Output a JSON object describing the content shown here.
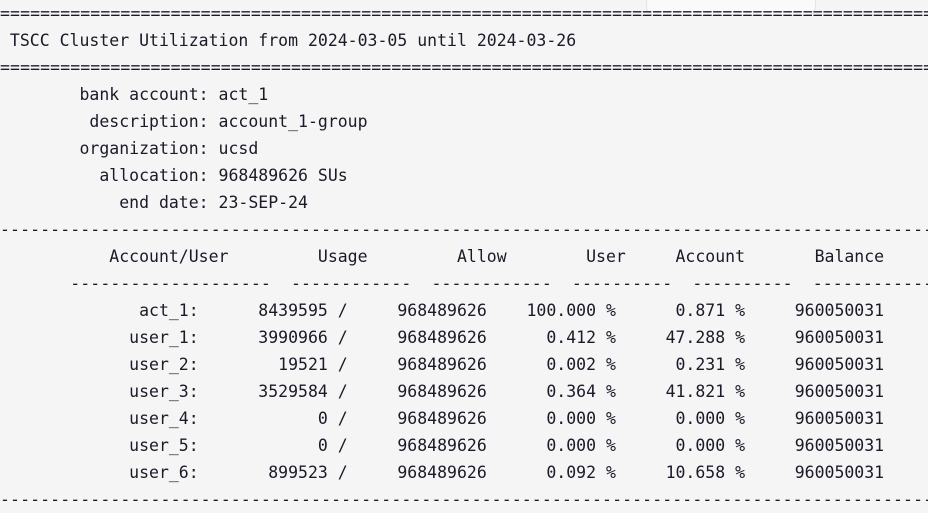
{
  "terminal": {
    "background_color": "#f5f5f5",
    "text_color": "#1a1a28",
    "rules": {
      "equals_rule": "================================================================================================",
      "dash_rule": "------------------------------------------------------------------------------------------------",
      "column_underline": "       --------------------  ------------  ------------  ----------  ----------  ------------"
    }
  },
  "header": {
    "title_line": " TSCC Cluster Utilization from 2024-03-05 until 2024-03-26",
    "title": "TSCC Cluster Utilization",
    "from_date": "2024-03-05",
    "until_date": "2024-03-26"
  },
  "metadata": {
    "lines": [
      "        bank account: act_1",
      "         description: account_1-group",
      "        organization: ucsd",
      "          allocation: 968489626 SUs",
      "            end date: 23-SEP-24"
    ],
    "fields": [
      {
        "label": "bank account",
        "value": "act_1"
      },
      {
        "label": "description",
        "value": "account_1-group"
      },
      {
        "label": "organization",
        "value": "ucsd"
      },
      {
        "label": "allocation",
        "value": "968489626 SUs"
      },
      {
        "label": "end date",
        "value": "23-SEP-24"
      }
    ]
  },
  "table": {
    "header_line": "           Account/User         Usage         Allow        User     Account       Balance",
    "columns": [
      "Account/User",
      "Usage",
      "Allow",
      "User",
      "Account",
      "Balance"
    ],
    "rows": [
      {
        "line": "              act_1:      8439595 /     968489626    100.000 %      0.871 %     960050031",
        "account_user": "act_1:",
        "usage": "8439595",
        "allow": "968489626",
        "user_pct": "100.000 %",
        "account_pct": "0.871 %",
        "balance": "960050031"
      },
      {
        "line": "             user_1:      3990966 /     968489626      0.412 %     47.288 %     960050031",
        "account_user": "user_1:",
        "usage": "3990966",
        "allow": "968489626",
        "user_pct": "0.412 %",
        "account_pct": "47.288 %",
        "balance": "960050031"
      },
      {
        "line": "             user_2:        19521 /     968489626      0.002 %      0.231 %     960050031",
        "account_user": "user_2:",
        "usage": "19521",
        "allow": "968489626",
        "user_pct": "0.002 %",
        "account_pct": "0.231 %",
        "balance": "960050031"
      },
      {
        "line": "             user_3:      3529584 /     968489626      0.364 %     41.821 %     960050031",
        "account_user": "user_3:",
        "usage": "3529584",
        "allow": "968489626",
        "user_pct": "0.364 %",
        "account_pct": "41.821 %",
        "balance": "960050031"
      },
      {
        "line": "             user_4:            0 /     968489626      0.000 %      0.000 %     960050031",
        "account_user": "user_4:",
        "usage": "0",
        "allow": "968489626",
        "user_pct": "0.000 %",
        "account_pct": "0.000 %",
        "balance": "960050031"
      },
      {
        "line": "             user_5:            0 /     968489626      0.000 %      0.000 %     960050031",
        "account_user": "user_5:",
        "usage": "0",
        "allow": "968489626",
        "user_pct": "0.000 %",
        "account_pct": "0.000 %",
        "balance": "960050031"
      },
      {
        "line": "             user_6:       899523 /     968489626      0.092 %     10.658 %     960050031",
        "account_user": "user_6:",
        "usage": "899523",
        "allow": "968489626",
        "user_pct": "0.092 %",
        "account_pct": "10.658 %",
        "balance": "960050031"
      }
    ]
  }
}
